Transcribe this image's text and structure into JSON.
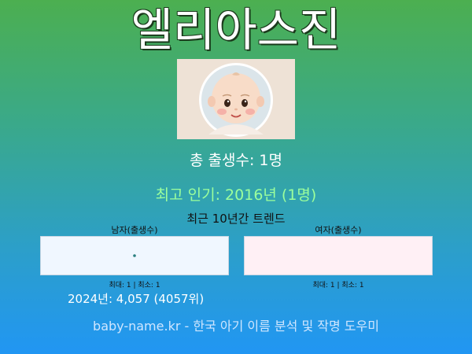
{
  "title": "엘리아스진",
  "summary": {
    "total_births": "총 출생수: 1명",
    "most_popular": "최고 인기: 2016년 (1명)",
    "trend_heading": "최근 10년간 트렌드"
  },
  "charts": {
    "male": {
      "label": "남자(출생수)",
      "stats": "최대: 1 | 최소: 1",
      "background": "#f0f7ff",
      "point_color": "#2a7f7f"
    },
    "female": {
      "label": "여자(출생수)",
      "stats": "최대: 1 | 최소: 1",
      "background": "#fff0f5"
    }
  },
  "year_stat": "2024년: 4,057 (4057위)",
  "footer": "baby-name.kr - 한국 아기 이름 분석 및 작명 도우미",
  "colors": {
    "popular_text": "#9cff9c",
    "gradient_top": "#4caf50",
    "gradient_bottom": "#2196f3"
  }
}
